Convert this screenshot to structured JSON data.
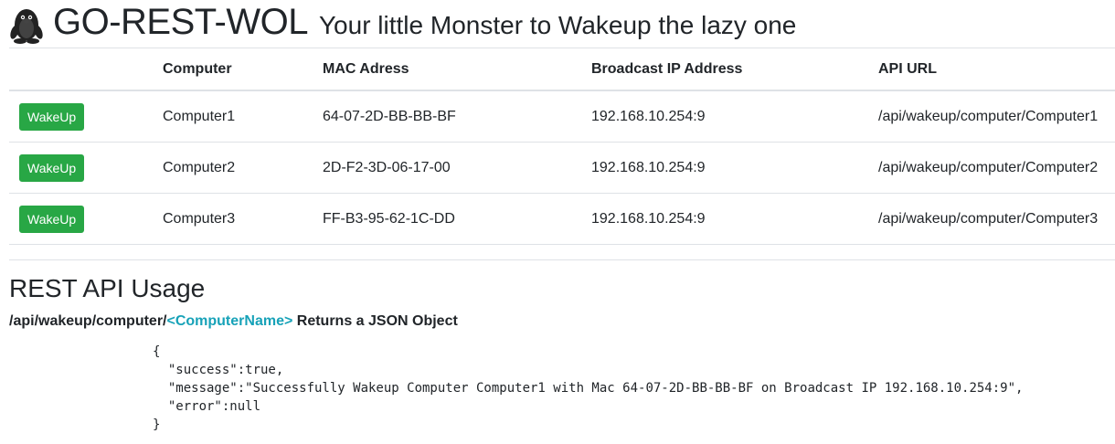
{
  "header": {
    "brand": "GO-REST-WOL",
    "tagline": "Your little Monster to Wakeup the lazy one",
    "logo_icon": "penguin-icon"
  },
  "table": {
    "columns": [
      "",
      "Computer",
      "MAC Adress",
      "Broadcast IP Address",
      "API URL"
    ],
    "rows": [
      {
        "button": "WakeUp",
        "computer": "Computer1",
        "mac": "64-07-2D-BB-BB-BF",
        "ip": "192.168.10.254:9",
        "url": "/api/wakeup/computer/Computer1"
      },
      {
        "button": "WakeUp",
        "computer": "Computer2",
        "mac": "2D-F2-3D-06-17-00",
        "ip": "192.168.10.254:9",
        "url": "/api/wakeup/computer/Computer2"
      },
      {
        "button": "WakeUp",
        "computer": "Computer3",
        "mac": "FF-B3-95-62-1C-DD",
        "ip": "192.168.10.254:9",
        "url": "/api/wakeup/computer/Computer3"
      }
    ]
  },
  "usage": {
    "title": "REST API Usage",
    "path": "/api/wakeup/computer/",
    "param": "<ComputerName>",
    "suffix": " Returns a JSON Object",
    "json_lines": [
      "{",
      "  \"success\":true,",
      "  \"message\":\"Successfully Wakeup Computer Computer1 with Mac 64-07-2D-BB-BB-BF on Broadcast IP 192.168.10.254:9\",",
      "  \"error\":null",
      "}"
    ]
  },
  "colors": {
    "button": "#28a745",
    "param": "#17a2b8",
    "text": "#212529",
    "border": "#dee2e6"
  }
}
